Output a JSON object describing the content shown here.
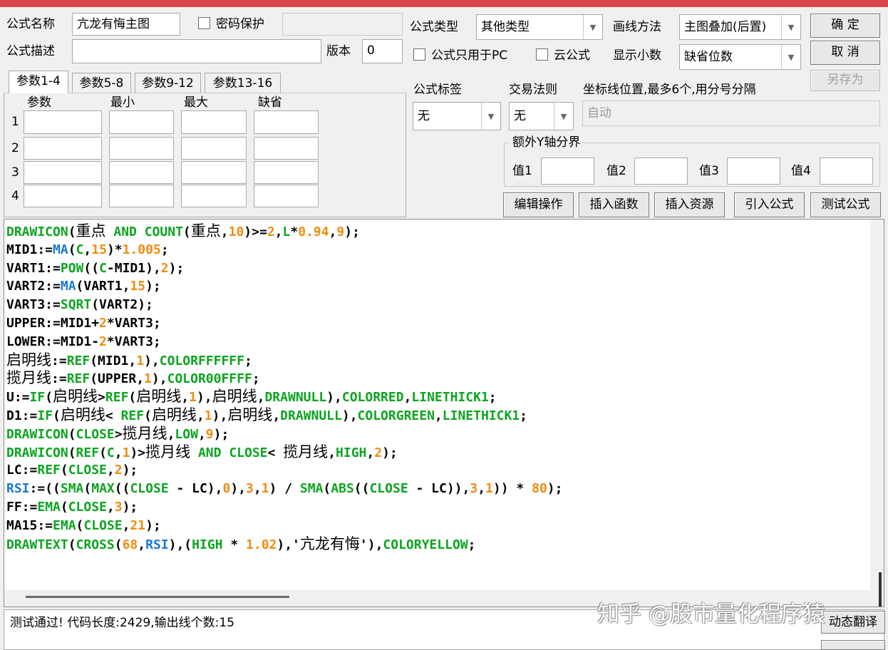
{
  "form": {
    "name_label": "公式名称",
    "name_value": "亢龙有悔主图",
    "password_label": "密码保护",
    "desc_label": "公式描述",
    "desc_value": "",
    "version_label": "版本",
    "version_value": "0",
    "type_label": "公式类型",
    "type_value": "其他类型",
    "draw_method_label": "画线方法",
    "draw_method_value": "主图叠加(后置)",
    "pc_only_label": "公式只用于PC",
    "cloud_label": "云公式",
    "decimals_label": "显示小数",
    "decimals_value": "缺省位数",
    "tag_label": "公式标签",
    "tag_value": "无",
    "trade_rule_label": "交易法则",
    "trade_rule_value": "无",
    "coord_label": "坐标线位置,最多6个,用分号分隔",
    "coord_placeholder": "自动",
    "yaxis_group_label": "额外Y轴分界",
    "yaxis_values": [
      "值1",
      "值2",
      "值3",
      "值4"
    ]
  },
  "buttons": {
    "ok": "确  定",
    "cancel": "取  消",
    "save_as": "另存为",
    "edit_ops": "编辑操作",
    "insert_func": "插入函数",
    "insert_res": "插入资源",
    "import_formula": "引入公式",
    "test_formula": "测试公式",
    "dynamic_translate": "动态翻译"
  },
  "params": {
    "tabs": [
      "参数1-4",
      "参数5-8",
      "参数9-12",
      "参数13-16"
    ],
    "columns": [
      "参数",
      "最小",
      "最大",
      "缺省"
    ],
    "rows": [
      "1",
      "2",
      "3",
      "4"
    ]
  },
  "code_lines": [
    [
      [
        "DRAWICON",
        "fn"
      ],
      [
        "(",
        ""
      ],
      [
        "重点",
        "cn"
      ],
      [
        " AND ",
        "fn"
      ],
      [
        "COUNT",
        "fn"
      ],
      [
        "(",
        ""
      ],
      [
        "重点",
        "cn"
      ],
      [
        ",",
        ""
      ],
      [
        "10",
        "num"
      ],
      [
        ")>=",
        ""
      ],
      [
        "2",
        "num"
      ],
      [
        ",",
        ""
      ],
      [
        "L",
        "fn"
      ],
      [
        "*",
        ""
      ],
      [
        "0.94",
        "num"
      ],
      [
        ",",
        ""
      ],
      [
        "9",
        "num"
      ],
      [
        ");",
        ""
      ]
    ],
    [
      [
        "MID1:=",
        ""
      ],
      [
        "MA",
        "blue"
      ],
      [
        "(",
        ""
      ],
      [
        "C",
        "fn"
      ],
      [
        ",",
        ""
      ],
      [
        "15",
        "num"
      ],
      [
        ")*",
        ""
      ],
      [
        "1.005",
        "num"
      ],
      [
        ";",
        ""
      ]
    ],
    [
      [
        "VART1:=",
        ""
      ],
      [
        "POW",
        "fn"
      ],
      [
        "((",
        ""
      ],
      [
        "C",
        "fn"
      ],
      [
        "-MID1),",
        ""
      ],
      [
        "2",
        "num"
      ],
      [
        ");",
        ""
      ]
    ],
    [
      [
        "VART2:=",
        ""
      ],
      [
        "MA",
        "blue"
      ],
      [
        "(VART1,",
        ""
      ],
      [
        "15",
        "num"
      ],
      [
        ");",
        ""
      ]
    ],
    [
      [
        "VART3:=",
        ""
      ],
      [
        "SQRT",
        "fn"
      ],
      [
        "(VART2);",
        ""
      ]
    ],
    [
      [
        "UPPER:=MID1+",
        ""
      ],
      [
        "2",
        "num"
      ],
      [
        "*VART3;",
        ""
      ]
    ],
    [
      [
        "LOWER:=MID1-",
        ""
      ],
      [
        "2",
        "num"
      ],
      [
        "*VART3;",
        ""
      ]
    ],
    [
      [
        "启明线",
        "cn"
      ],
      [
        ":=",
        ""
      ],
      [
        "REF",
        "fn"
      ],
      [
        "(MID1,",
        ""
      ],
      [
        "1",
        "num"
      ],
      [
        "),",
        ""
      ],
      [
        "COLORFFFFFF",
        "fn"
      ],
      [
        ";",
        ""
      ]
    ],
    [
      [
        "揽月线",
        "cn"
      ],
      [
        ":=",
        ""
      ],
      [
        "REF",
        "fn"
      ],
      [
        "(UPPER,",
        ""
      ],
      [
        "1",
        "num"
      ],
      [
        "),",
        ""
      ],
      [
        "COLOR00FFFF",
        "fn"
      ],
      [
        ";",
        ""
      ]
    ],
    [
      [
        "U:=",
        ""
      ],
      [
        "IF",
        "fn"
      ],
      [
        "(",
        ""
      ],
      [
        "启明线",
        "cn"
      ],
      [
        ">",
        ""
      ],
      [
        "REF",
        "fn"
      ],
      [
        "(",
        ""
      ],
      [
        "启明线",
        "cn"
      ],
      [
        ",",
        ""
      ],
      [
        "1",
        "num"
      ],
      [
        "),",
        ""
      ],
      [
        "启明线",
        "cn"
      ],
      [
        ",",
        ""
      ],
      [
        "DRAWNULL",
        "fn"
      ],
      [
        "),",
        ""
      ],
      [
        "COLORRED",
        "fn"
      ],
      [
        ",",
        ""
      ],
      [
        "LINETHICK1",
        "fn"
      ],
      [
        ";",
        ""
      ]
    ],
    [
      [
        "D1:=",
        ""
      ],
      [
        "IF",
        "fn"
      ],
      [
        "(",
        ""
      ],
      [
        "启明线",
        "cn"
      ],
      [
        "< ",
        ""
      ],
      [
        "REF",
        "fn"
      ],
      [
        "(",
        ""
      ],
      [
        "启明线",
        "cn"
      ],
      [
        ",",
        ""
      ],
      [
        "1",
        "num"
      ],
      [
        "),",
        ""
      ],
      [
        "启明线",
        "cn"
      ],
      [
        ",",
        ""
      ],
      [
        "DRAWNULL",
        "fn"
      ],
      [
        "),",
        ""
      ],
      [
        "COLORGREEN",
        "fn"
      ],
      [
        ",",
        ""
      ],
      [
        "LINETHICK1",
        "fn"
      ],
      [
        ";",
        ""
      ]
    ],
    [
      [
        "DRAWICON",
        "fn"
      ],
      [
        "(",
        ""
      ],
      [
        "CLOSE",
        "fn"
      ],
      [
        ">",
        ""
      ],
      [
        "揽月线",
        "cn"
      ],
      [
        ",",
        ""
      ],
      [
        "LOW",
        "fn"
      ],
      [
        ",",
        ""
      ],
      [
        "9",
        "num"
      ],
      [
        ");",
        ""
      ]
    ],
    [
      [
        "DRAWICON",
        "fn"
      ],
      [
        "(",
        ""
      ],
      [
        "REF",
        "fn"
      ],
      [
        "(",
        ""
      ],
      [
        "C",
        "fn"
      ],
      [
        ",",
        ""
      ],
      [
        "1",
        "num"
      ],
      [
        ")>",
        ""
      ],
      [
        "揽月线",
        "cn"
      ],
      [
        " AND ",
        "fn"
      ],
      [
        "CLOSE",
        "fn"
      ],
      [
        "< ",
        ""
      ],
      [
        "揽月线",
        "cn"
      ],
      [
        ",",
        ""
      ],
      [
        "HIGH",
        "fn"
      ],
      [
        ",",
        ""
      ],
      [
        "2",
        "num"
      ],
      [
        ");",
        ""
      ]
    ],
    [
      [
        "LC:=",
        ""
      ],
      [
        "REF",
        "fn"
      ],
      [
        "(",
        ""
      ],
      [
        "CLOSE",
        "fn"
      ],
      [
        ",",
        ""
      ],
      [
        "2",
        "num"
      ],
      [
        ");",
        ""
      ]
    ],
    [
      [
        "RSI",
        "blue"
      ],
      [
        ":=((",
        ""
      ],
      [
        "SMA",
        "fn"
      ],
      [
        "(",
        ""
      ],
      [
        "MAX",
        "fn"
      ],
      [
        "((",
        ""
      ],
      [
        "CLOSE",
        "fn"
      ],
      [
        " - LC),",
        ""
      ],
      [
        "0",
        "num"
      ],
      [
        "),",
        ""
      ],
      [
        "3",
        "num"
      ],
      [
        ",",
        ""
      ],
      [
        "1",
        "num"
      ],
      [
        ") / ",
        ""
      ],
      [
        "SMA",
        "fn"
      ],
      [
        "(",
        ""
      ],
      [
        "ABS",
        "fn"
      ],
      [
        "((",
        ""
      ],
      [
        "CLOSE",
        "fn"
      ],
      [
        " - LC)),",
        ""
      ],
      [
        "3",
        "num"
      ],
      [
        ",",
        ""
      ],
      [
        "1",
        "num"
      ],
      [
        ")) * ",
        ""
      ],
      [
        "80",
        "num"
      ],
      [
        ");",
        ""
      ]
    ],
    [
      [
        "FF:=",
        ""
      ],
      [
        "EMA",
        "fn"
      ],
      [
        "(",
        ""
      ],
      [
        "CLOSE",
        "fn"
      ],
      [
        ",",
        ""
      ],
      [
        "3",
        "num"
      ],
      [
        ");",
        ""
      ]
    ],
    [
      [
        "MA15:=",
        ""
      ],
      [
        "EMA",
        "fn"
      ],
      [
        "(",
        ""
      ],
      [
        "CLOSE",
        "fn"
      ],
      [
        ",",
        ""
      ],
      [
        "21",
        "num"
      ],
      [
        ");",
        ""
      ]
    ],
    [
      [
        "DRAWTEXT",
        "fn"
      ],
      [
        "(",
        ""
      ],
      [
        "CROSS",
        "fn"
      ],
      [
        "(",
        ""
      ],
      [
        "68",
        "num"
      ],
      [
        ",",
        ""
      ],
      [
        "RSI",
        "blue"
      ],
      [
        "),(",
        ""
      ],
      [
        "HIGH",
        "fn"
      ],
      [
        " * ",
        ""
      ],
      [
        "1.02",
        "num"
      ],
      [
        "),'",
        ""
      ],
      [
        "亢龙有悔",
        "cn"
      ],
      [
        "'),",
        ""
      ],
      [
        "COLORYELLOW",
        "fn"
      ],
      [
        ";",
        ""
      ]
    ]
  ],
  "status_text": "测试通过! 代码长度:2429,输出线个数:15",
  "watermark": "知乎 @股市量化程序猿"
}
